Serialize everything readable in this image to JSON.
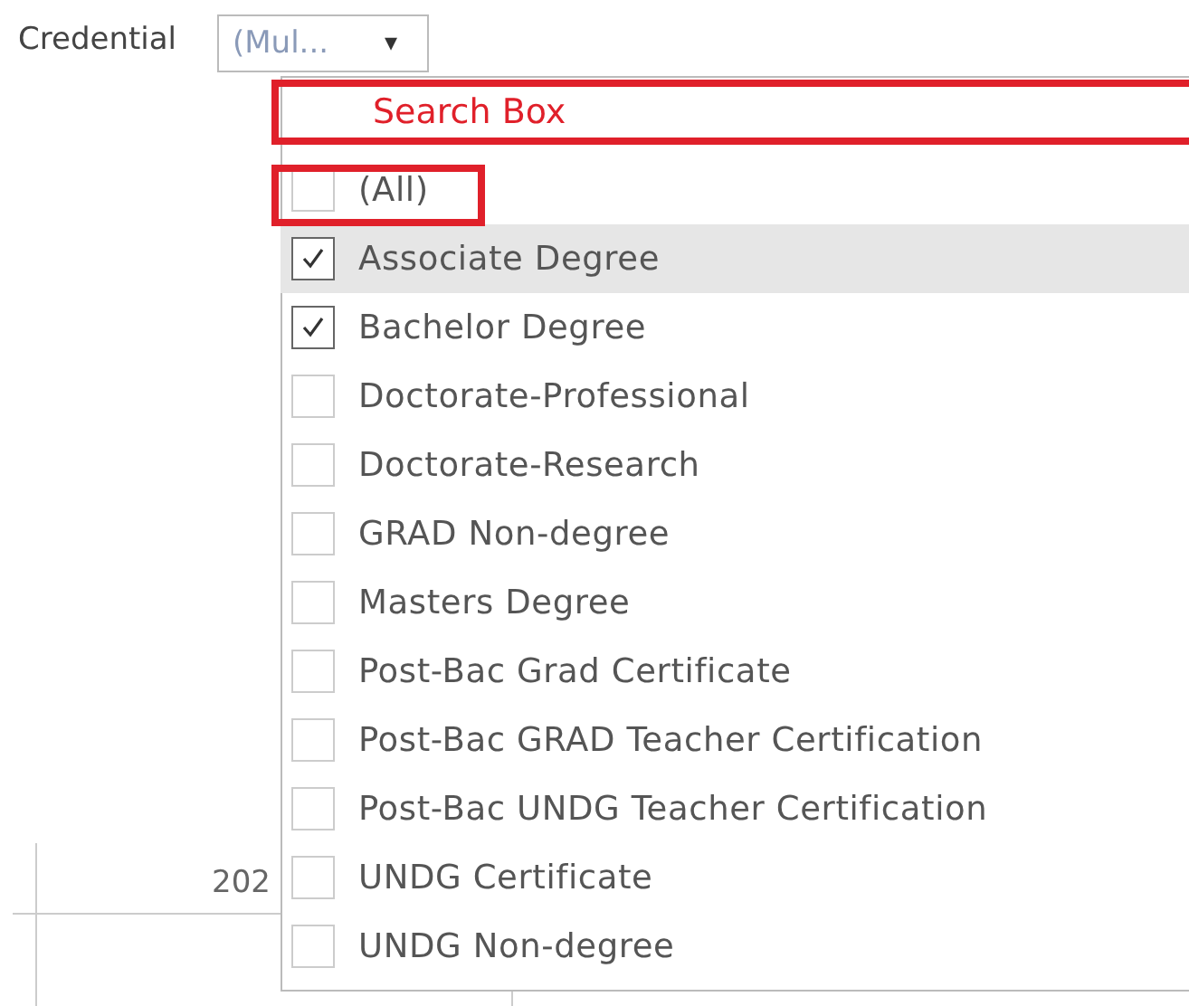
{
  "filter": {
    "label": "Credential",
    "value": "(Mul...",
    "caret": "▾"
  },
  "search": {
    "value": "Search Box",
    "highlighted": true
  },
  "items": [
    {
      "label": "(All)",
      "checked": false,
      "hovered": false,
      "highlighted": true
    },
    {
      "label": "Associate Degree",
      "checked": true,
      "hovered": true,
      "highlighted": false
    },
    {
      "label": "Bachelor Degree",
      "checked": true,
      "hovered": false,
      "highlighted": false
    },
    {
      "label": "Doctorate-Professional",
      "checked": false,
      "hovered": false,
      "highlighted": false
    },
    {
      "label": "Doctorate-Research",
      "checked": false,
      "hovered": false,
      "highlighted": false
    },
    {
      "label": "GRAD Non-degree",
      "checked": false,
      "hovered": false,
      "highlighted": false
    },
    {
      "label": "Masters Degree",
      "checked": false,
      "hovered": false,
      "highlighted": false
    },
    {
      "label": "Post-Bac Grad Certificate",
      "checked": false,
      "hovered": false,
      "highlighted": false
    },
    {
      "label": "Post-Bac GRAD Teacher Certification",
      "checked": false,
      "hovered": false,
      "highlighted": false
    },
    {
      "label": "Post-Bac UNDG Teacher Certification",
      "checked": false,
      "hovered": false,
      "highlighted": false
    },
    {
      "label": "UNDG Certificate",
      "checked": false,
      "hovered": false,
      "highlighted": false
    },
    {
      "label": "UNDG Non-degree",
      "checked": false,
      "hovered": false,
      "highlighted": false
    }
  ],
  "background_axis": {
    "label": "202"
  }
}
